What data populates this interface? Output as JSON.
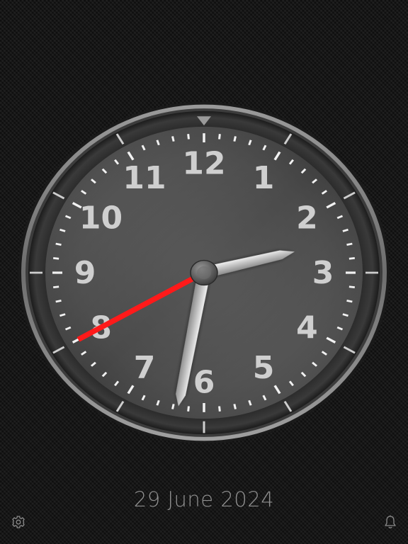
{
  "clock": {
    "numerals": [
      "12",
      "1",
      "2",
      "3",
      "4",
      "5",
      "6",
      "7",
      "8",
      "9",
      "10",
      "11"
    ],
    "time": {
      "hour": 2,
      "minute": 31,
      "second": 40
    },
    "colors": {
      "dial": "#4a4a4a",
      "bezel": "#2e2e2e",
      "hands": "#d8d8d8",
      "second_hand": "#ff0000",
      "numerals": "#cfcfcf",
      "ticks": "#f0f0f0"
    }
  },
  "date": {
    "label": "29 June 2024"
  },
  "toolbar": {
    "settings_icon": "gear-icon",
    "alarm_icon": "bell-icon"
  }
}
